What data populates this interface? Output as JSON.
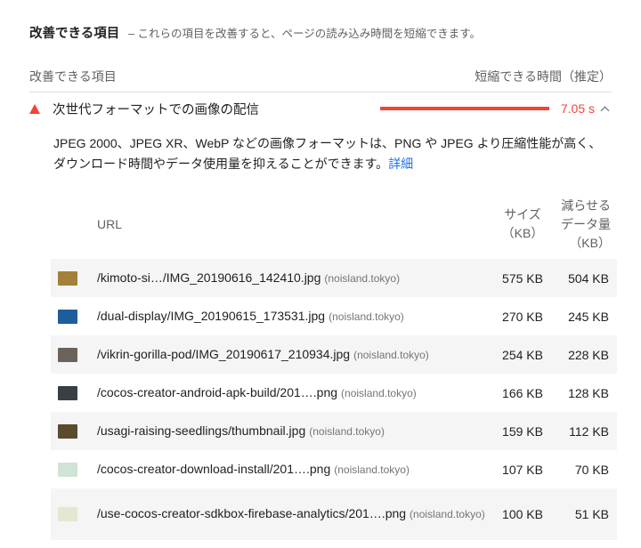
{
  "section": {
    "title": "改善できる項目",
    "description": "– これらの項目を改善すると、ページの読み込み時間を短縮できます。"
  },
  "columns": {
    "left": "改善できる項目",
    "right": "短縮できる時間（推定）"
  },
  "audit": {
    "title": "次世代フォーマットでの画像の配信",
    "savings": "7.05 s",
    "description": "JPEG 2000、JPEG XR、WebP などの画像フォーマットは、PNG や JPEG より圧縮性能が高く、ダウンロード時間やデータ使用量を抑えることができます。",
    "link": "詳細"
  },
  "table": {
    "headers": {
      "url": "URL",
      "size": "サイズ（KB）",
      "saved": "減らせるデータ量（KB）"
    },
    "rows": [
      {
        "url": "/kimoto-si…/IMG_20190616_142410.jpg",
        "host": "(noisland.tokyo)",
        "size": "575 KB",
        "saved": "504 KB",
        "thumb_color": "#a3813a"
      },
      {
        "url": "/dual-display/IMG_20190615_173531.jpg",
        "host": "(noisland.tokyo)",
        "size": "270 KB",
        "saved": "245 KB",
        "thumb_color": "#1c5d9c"
      },
      {
        "url": "/vikrin-gorilla-pod/IMG_20190617_210934.jpg",
        "host": "(noisland.tokyo)",
        "size": "254 KB",
        "saved": "228 KB",
        "thumb_color": "#6b625a"
      },
      {
        "url": "/cocos-creator-android-apk-build/201….png",
        "host": "(noisland.tokyo)",
        "size": "166 KB",
        "saved": "128 KB",
        "thumb_color": "#3a3f44"
      },
      {
        "url": "/usagi-raising-seedlings/thumbnail.jpg",
        "host": "(noisland.tokyo)",
        "size": "159 KB",
        "saved": "112 KB",
        "thumb_color": "#5b4a2e"
      },
      {
        "url": "/cocos-creator-download-install/201….png",
        "host": "(noisland.tokyo)",
        "size": "107 KB",
        "saved": "70 KB",
        "thumb_color": "#cfe3d6"
      },
      {
        "url": "/use-cocos-creator-sdkbox-firebase-analytics/201….png",
        "host": "(noisland.tokyo)",
        "size": "100 KB",
        "saved": "51 KB",
        "thumb_color": "#e3e8d2"
      }
    ]
  }
}
